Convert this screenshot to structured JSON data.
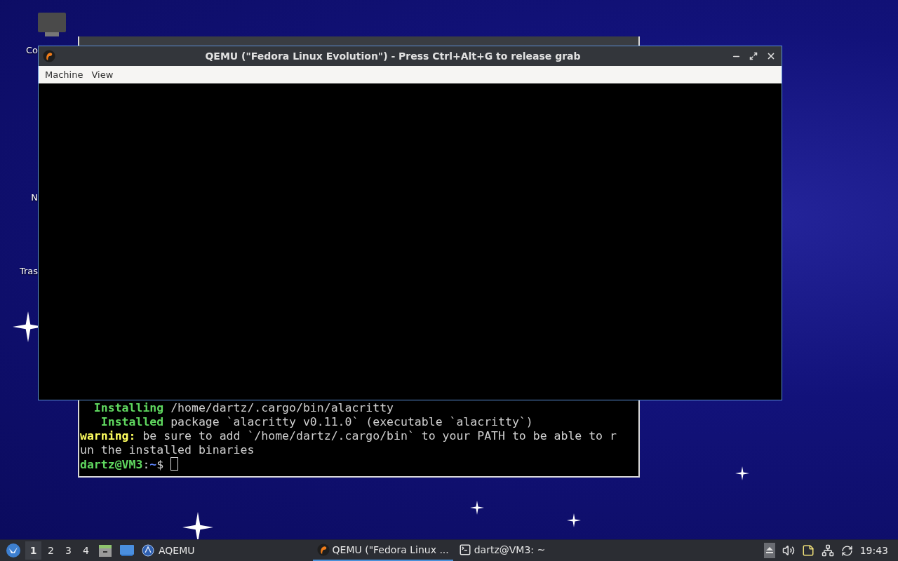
{
  "desktop": {
    "icons": [
      {
        "label": "Co"
      },
      {
        "label": "N"
      },
      {
        "label": "Tras"
      }
    ]
  },
  "terminal_window": {
    "lines": [
      {
        "segments": [
          {
            "kind": "status",
            "text": "  Installing"
          },
          {
            "kind": "plain",
            "text": " /home/dartz/.cargo/bin/alacritty"
          }
        ]
      },
      {
        "segments": [
          {
            "kind": "status",
            "text": "   Installed"
          },
          {
            "kind": "plain",
            "text": " package `alacritty v0.11.0` (executable `alacritty`)"
          }
        ]
      },
      {
        "segments": [
          {
            "kind": "warning",
            "text": "warning:"
          },
          {
            "kind": "plain",
            "text": " be sure to add `/home/dartz/.cargo/bin` to your PATH to be able to r"
          }
        ]
      },
      {
        "segments": [
          {
            "kind": "plain",
            "text": "un the installed binaries"
          }
        ]
      },
      {
        "segments": [
          {
            "kind": "user",
            "text": "dartz@VM3"
          },
          {
            "kind": "plain",
            "text": ":"
          },
          {
            "kind": "path",
            "text": "~"
          },
          {
            "kind": "plain",
            "text": "$ "
          },
          {
            "kind": "cursor"
          }
        ]
      }
    ]
  },
  "qemu_window": {
    "title": "QEMU (\"Fedora Linux Evolution\") - Press Ctrl+Alt+G to release grab",
    "menu": [
      "Machine",
      "View"
    ]
  },
  "taskbar": {
    "workspaces": [
      {
        "label": "1",
        "selected": true
      },
      {
        "label": "2",
        "selected": false
      },
      {
        "label": "3",
        "selected": false
      },
      {
        "label": "4",
        "selected": false
      }
    ],
    "launcher": {
      "label": "AQEMU"
    },
    "tasks": [
      {
        "kind": "qemu",
        "label": "QEMU (\"Fedora Linux ...",
        "selected": true
      },
      {
        "kind": "terminal",
        "label": "dartz@VM3: ~",
        "selected": false
      }
    ],
    "clock": "19:43"
  }
}
